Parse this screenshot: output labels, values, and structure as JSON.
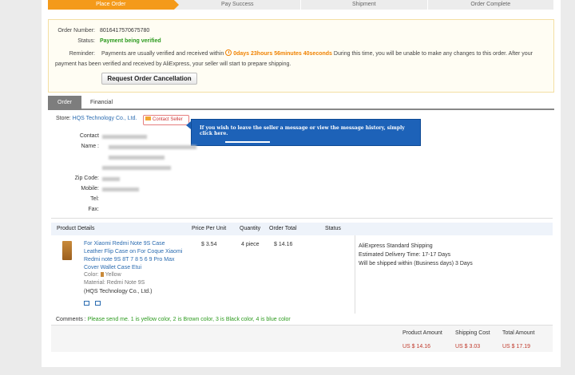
{
  "progress": {
    "steps": [
      "Place Order",
      "Pay Success",
      "Shipment",
      "Order Complete"
    ]
  },
  "status": {
    "order_number_label": "Order Number:",
    "order_number": "8016417570675780",
    "status_label": "Status:",
    "status_value": "Payment being verified",
    "reminder_label": "Reminder:",
    "reminder_text_1": "Payments are usually verified and received within",
    "countdown": "0days 23hours 56minutes 40seconds",
    "reminder_text_2": "During this time, you will be unable to make any changes to this order. After your payment has been verified and received by AliExpress, your seller will start to prepare shipping.",
    "cancel_button": "Request Order Cancellation"
  },
  "tabs": [
    "Order",
    "Financial"
  ],
  "store": {
    "label": "Store:",
    "name": "HQS Technology Co., Ltd.",
    "contact_button": "Contact Seller",
    "tooltip": "If you wish to leave the seller a message or view the message history, simply click here."
  },
  "contact": {
    "contact_label": "Contact",
    "name_label": "Name :",
    "zip_label": "Zip Code:",
    "mobile_label": "Mobile:",
    "tel_label": "Tel:",
    "fax_label": "Fax:"
  },
  "table": {
    "headers": [
      "Product Details",
      "Price Per Unit",
      "Quantity",
      "Order Total",
      "Status"
    ],
    "product_name": "For Xiaomi Redmi Note 9S Case Leather Flip Case on For Coque Xiaomi Redmi note 9S 8T 7 8 5 6 9 Pro Max Cover Wallet Case Etui",
    "color_label": "Color:",
    "color_value": "Yellow",
    "material_label": "Material:",
    "material_value": "Redmi Note 9S",
    "seller": "(HQS Technology Co., Ltd.)",
    "price": "$ 3.54",
    "quantity": "4 piece",
    "order_total": "$ 14.16"
  },
  "shipping": {
    "method": "AliExpress Standard Shipping",
    "delivery": "Estimated Delivery Time:  17-17 Days",
    "ship_within": "Will be shipped within (Business days) 3 Days"
  },
  "comments": {
    "label": "Comments :",
    "value": "Please send me. 1 is yellow color, 2 is Brown color, 3 is Black color, 4 is blue color"
  },
  "totals": {
    "product_amount_label": "Product Amount",
    "shipping_cost_label": "Shipping Cost",
    "total_amount_label": "Total Amount",
    "product_amount": "US $ 14.16",
    "shipping_cost": "US $ 3.03",
    "total_amount": "US $ 17.19"
  },
  "colors": {
    "accent": "#f49a1a",
    "link": "#2a6bb0",
    "status_green": "#2c9a1e",
    "price_red": "#c0392b",
    "tooltip_blue": "#1d62b8"
  }
}
